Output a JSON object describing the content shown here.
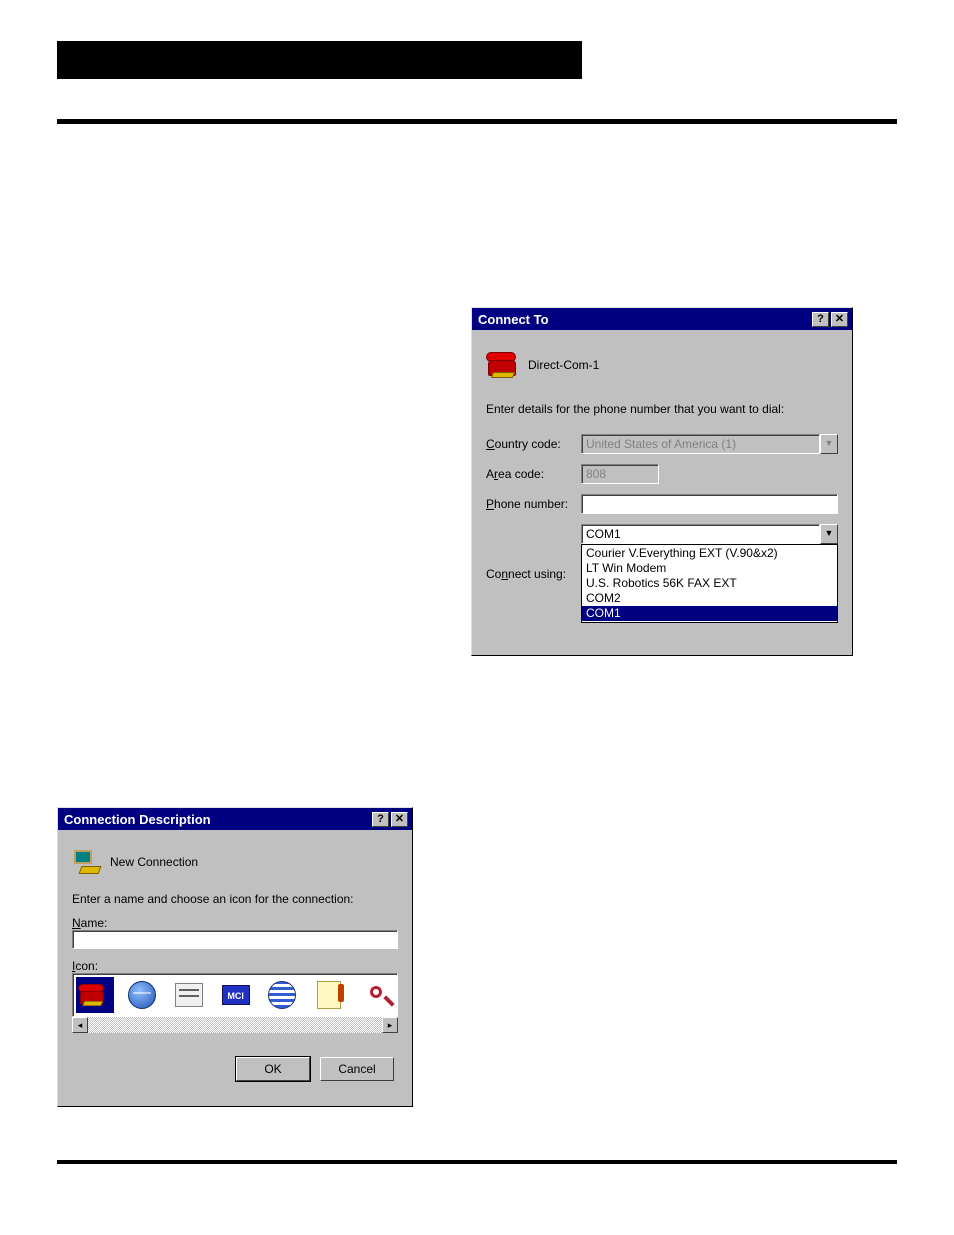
{
  "connect_to": {
    "title": "Connect To",
    "icon_name": "phone-icon",
    "connection_name": "Direct-Com-1",
    "instruction": "Enter details for the phone number that you want to dial:",
    "country_label_pre": "C",
    "country_label_rest": "ountry code:",
    "country_value": "United States of America (1)",
    "area_label_pre": "A",
    "area_label_rest": "rea code:",
    "area_value": "808",
    "phone_label_pre": "P",
    "phone_label_rest": "hone number:",
    "phone_value": "",
    "connect_label_pre": "Co",
    "connect_label_underline": "n",
    "connect_label_rest": "nect using:",
    "connect_value": "COM1",
    "options": [
      "Courier V.Everything EXT (V.90&x2)",
      "LT Win Modem",
      "U.S. Robotics 56K FAX EXT",
      "COM2",
      "COM1"
    ],
    "selected_option_index": 4
  },
  "conn_desc": {
    "title": "Connection Description",
    "header_text": "New Connection",
    "instruction": "Enter a name and choose an icon for the connection:",
    "name_label_pre": "N",
    "name_label_rest": "ame:",
    "name_value": "",
    "icon_label_pre": "I",
    "icon_label_rest": "con:",
    "ok_label": "OK",
    "cancel_label": "Cancel",
    "mci_text": "MCI",
    "selected_icon_index": 0
  }
}
